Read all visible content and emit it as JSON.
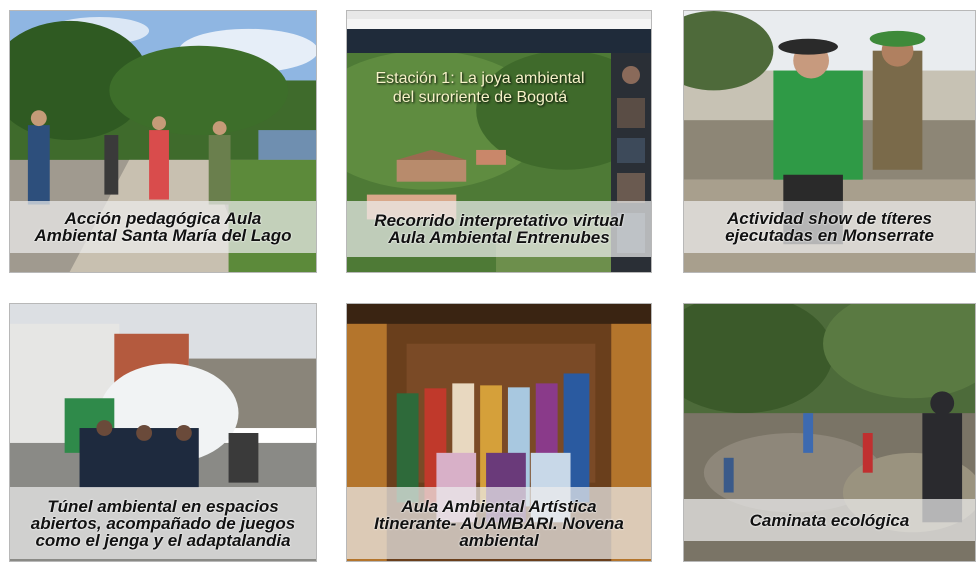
{
  "tiles": [
    {
      "caption": "Acción pedagógica Aula\nAmbiental Santa María del Lago"
    },
    {
      "caption": "Recorrido interpretativo virtual\nAula Ambiental Entrenubes",
      "slide_title": "Estación 1: La joya ambiental\ndel suroriente de Bogotá"
    },
    {
      "caption": "Actividad show de títeres\nejecutadas en Monserrate"
    },
    {
      "caption": "Túnel ambiental en espacios\nabiertos, acompañado de juegos\ncomo el jenga y el adaptalandia"
    },
    {
      "caption": "Aula Ambiental Artística\nItinerante- AUAMBARI. Novena\nambiental"
    },
    {
      "caption": "Caminata ecológica"
    }
  ]
}
